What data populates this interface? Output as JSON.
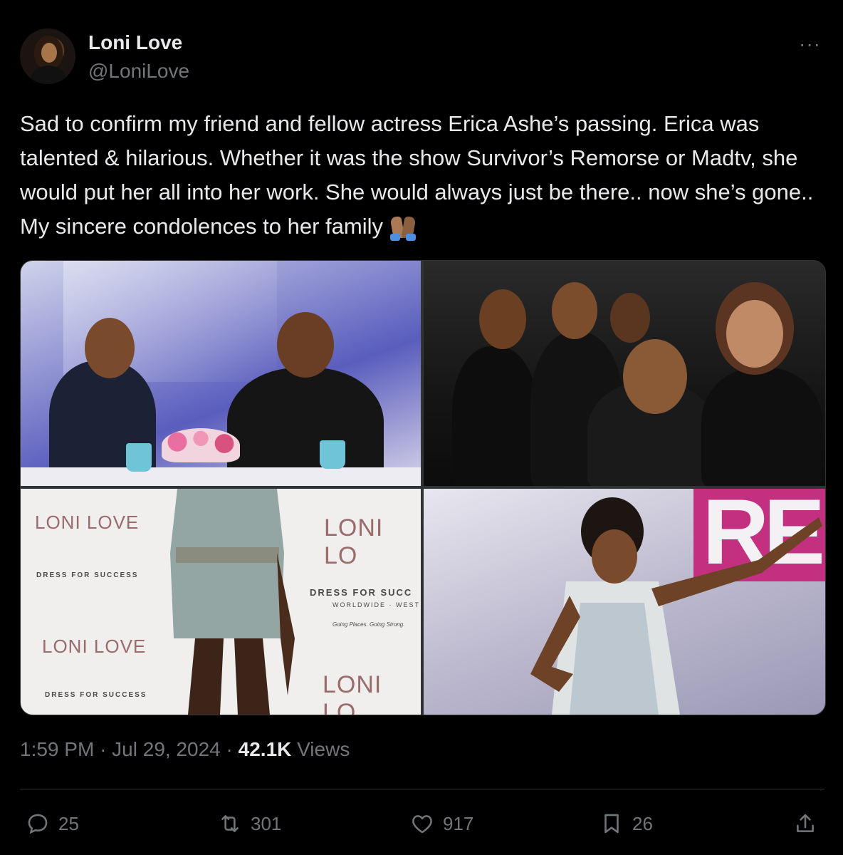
{
  "author": {
    "display_name": "Loni Love",
    "handle": "@LoniLove"
  },
  "more_icon": "···",
  "tweet": {
    "text": "Sad to confirm my friend and fellow actress Erica Ashe’s passing. Erica was talented & hilarious. Whether it was the show Survivor’s  Remorse or Madtv, she would put her all into her work. She would always just be there.. now she’s gone.. My sincere condolences to her family"
  },
  "media": {
    "photo3": {
      "brand_1": "LONI LOVE",
      "brand_2": "LONI LO",
      "brand_3": "LONI LOVE",
      "brand_4": "LONI LO",
      "sponsor_1": "DRESS FOR SUCCESS",
      "sponsor_2": "DRESS FOR SUCC",
      "sponsor_2_sub": "WORLDWIDE · WEST",
      "sponsor_2_tag": "Going Places. Going Strong.",
      "sponsor_3": "DRESS FOR SUCCESS"
    },
    "photo4": {
      "sign": "RE"
    }
  },
  "meta": {
    "time": "1:59 PM",
    "date": "Jul 29, 2024",
    "views_count": "42.1K",
    "views_label": "Views"
  },
  "actions": {
    "replies": "25",
    "reposts": "301",
    "likes": "917",
    "bookmarks": "26"
  },
  "icons": [
    "reply-icon",
    "repost-icon",
    "like-icon",
    "bookmark-icon",
    "share-icon",
    "more-icon"
  ]
}
